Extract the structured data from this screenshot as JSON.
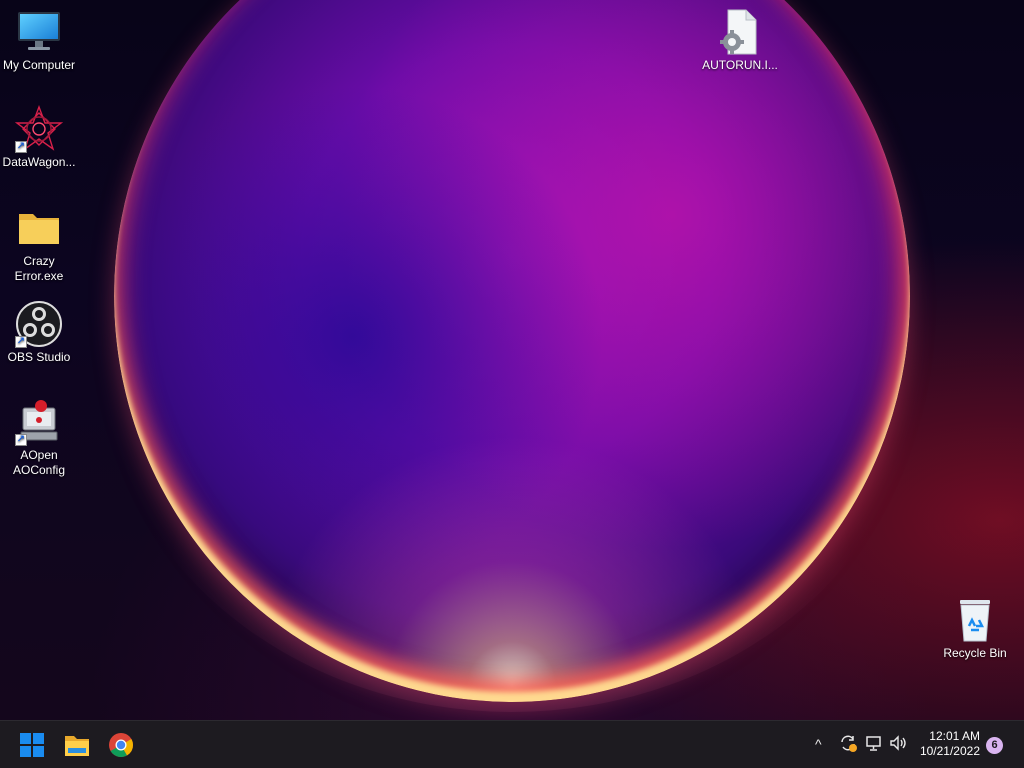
{
  "desktop": {
    "icons": [
      {
        "label": "My Computer",
        "icon": "monitor-icon"
      },
      {
        "label": "DataWagon...",
        "icon": "datawagon-app-icon",
        "shortcut": true
      },
      {
        "label": "Crazy Error.exe",
        "icon": "folder-icon"
      },
      {
        "label": "OBS Studio",
        "icon": "obs-studio-icon",
        "shortcut": true
      },
      {
        "label": "AOpen AOConfig",
        "icon": "aoconfig-icon",
        "shortcut": true
      },
      {
        "label": "AUTORUN.I...",
        "icon": "settings-file-icon"
      },
      {
        "label": "Recycle Bin",
        "icon": "recycle-bin-icon"
      }
    ]
  },
  "taskbar": {
    "pinned": [
      {
        "name": "Start",
        "icon": "windows-start-icon"
      },
      {
        "name": "File Explorer",
        "icon": "file-explorer-icon"
      },
      {
        "name": "Google Chrome",
        "icon": "chrome-icon"
      }
    ],
    "tray": {
      "chevron": "^",
      "time": "12:01 AM",
      "date": "10/21/2022",
      "notifications": "6"
    }
  },
  "colors": {
    "taskbar_bg": "#1d1b20",
    "windows_blue": "#1a8cf0",
    "notification_badge": "#d9b4f0"
  }
}
